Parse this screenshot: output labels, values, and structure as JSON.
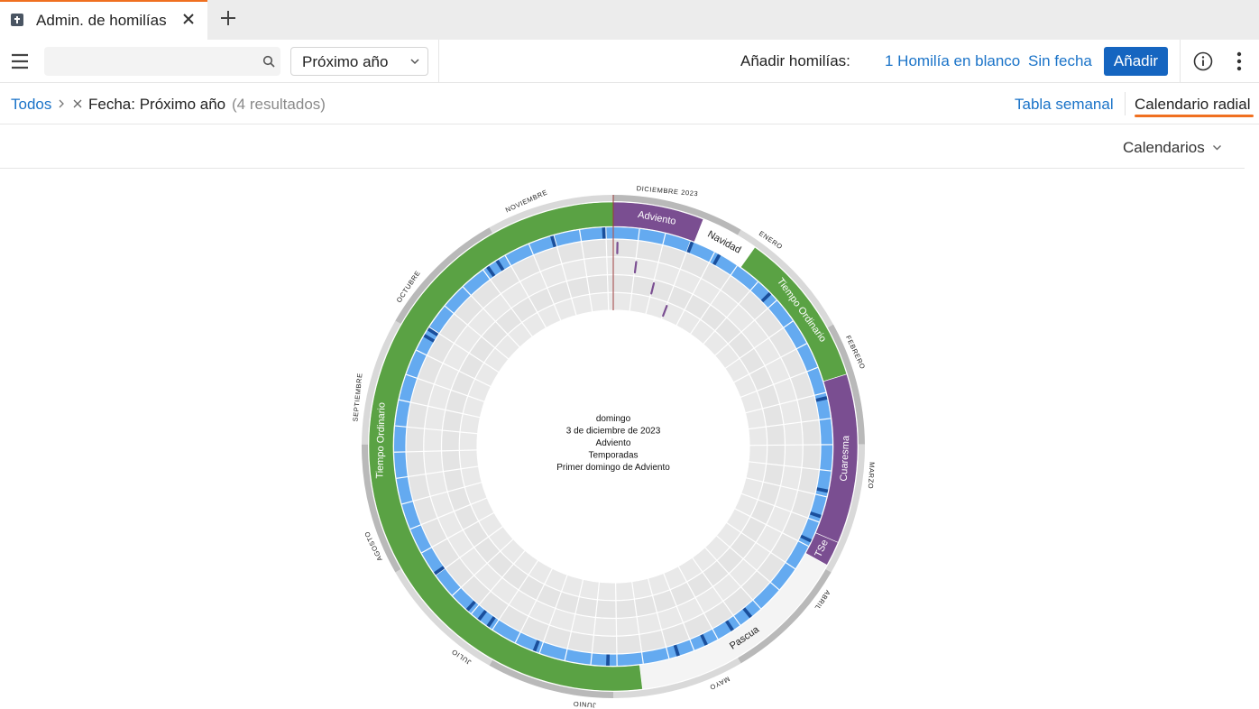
{
  "tab": {
    "title": "Admin. de homilías"
  },
  "toolbar": {
    "search_value": "",
    "select_value": "Próximo año",
    "add_label": "Añadir homilías:",
    "link_blank": "1 Homilía en blanco",
    "link_nodate": "Sin fecha",
    "add_button": "Añadir"
  },
  "breadcrumb": {
    "root": "Todos",
    "filter": "Fecha: Próximo año",
    "count": "(4 resultados)"
  },
  "views": {
    "tabla": "Tabla semanal",
    "radial": "Calendario radial"
  },
  "calendars_dropdown": "Calendarios",
  "colors": {
    "accent": "#f07020",
    "link": "#1a73c8",
    "primary_button": "#1565c0",
    "advent": "#7a4e91",
    "ordinary": "#5aa244",
    "week": "#64aaf0",
    "week_marker": "#1a4f9c"
  },
  "radial": {
    "center_lines": [
      "domingo",
      "3 de diciembre de 2023",
      "Adviento",
      "Temporadas",
      "Primer domingo de Adviento"
    ],
    "months": [
      {
        "label": "DICIEMBRE 2023",
        "start": 0,
        "end": 31
      },
      {
        "label": "ENERO",
        "start": 31,
        "end": 62
      },
      {
        "label": "FEBRERO",
        "start": 62,
        "end": 91
      },
      {
        "label": "MARZO",
        "start": 91,
        "end": 122
      },
      {
        "label": "ABRIL",
        "start": 122,
        "end": 152
      },
      {
        "label": "MAYO",
        "start": 152,
        "end": 183
      },
      {
        "label": "JUNIO",
        "start": 183,
        "end": 213
      },
      {
        "label": "JULIO",
        "start": 213,
        "end": 244
      },
      {
        "label": "AGOSTO",
        "start": 244,
        "end": 275
      },
      {
        "label": "SEPTIEMBRE",
        "start": 275,
        "end": 305
      },
      {
        "label": "OCTUBRE",
        "start": 305,
        "end": 336
      },
      {
        "label": "NOVIEMBRE",
        "start": 336,
        "end": 366
      }
    ],
    "seasons": [
      {
        "label": "Adviento",
        "start": 0,
        "end": 22,
        "color": "#7a4e91",
        "text_color": "#ffffff"
      },
      {
        "label": "Navidad",
        "start": 22,
        "end": 36,
        "color": "#ffffff",
        "text_color": "#222222"
      },
      {
        "label": "Tiempo Ordinario",
        "start": 36,
        "end": 74,
        "color": "#5aa244",
        "text_color": "#ffffff"
      },
      {
        "label": "Cuaresma",
        "start": 74,
        "end": 115,
        "color": "#7a4e91",
        "text_color": "#ffffff"
      },
      {
        "label": "TSe",
        "start": 115,
        "end": 121,
        "color": "#7a4e91",
        "text_color": "#ffffff"
      },
      {
        "label": "Pascua",
        "start": 121,
        "end": 176,
        "color": "#f4f4f4",
        "text_color": "#222222"
      },
      {
        "label": "Tiempo Ordinario",
        "start": 176,
        "end": 366,
        "color": "#5aa244",
        "text_color": "#ffffff"
      }
    ],
    "week_markers": [
      21,
      29,
      46,
      78,
      103,
      110,
      117,
      143,
      149,
      157,
      165,
      184,
      204,
      218,
      221,
      225,
      238,
      305,
      307,
      330,
      333,
      349,
      363
    ],
    "homilies": [
      {
        "day": 0,
        "ring": 0
      },
      {
        "day": 6,
        "ring": 1
      },
      {
        "day": 13,
        "ring": 2
      },
      {
        "day": 20,
        "ring": 3
      }
    ]
  }
}
